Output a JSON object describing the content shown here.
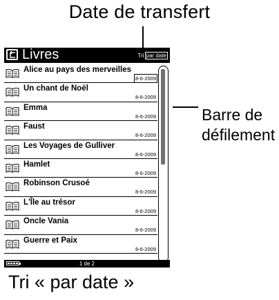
{
  "callouts": {
    "top": "Date de transfert",
    "right_line1": "Barre de",
    "right_line2": "défilement",
    "bottom": "Tri « par date »"
  },
  "header": {
    "back_icon": "back-arrow-icon",
    "title": "Livres",
    "sort_prefix": "Tri",
    "sort_value": "par date"
  },
  "books": [
    {
      "title": "Alice au pays des merveilles",
      "date": "8-6-2009",
      "icon": "book-icon",
      "highlighted": true
    },
    {
      "title": "Un chant de Noël",
      "date": "8-6-2009",
      "icon": "book-icon"
    },
    {
      "title": "Emma",
      "date": "8-6-2009",
      "icon": "book-icon"
    },
    {
      "title": "Faust",
      "date": "8-6-2009",
      "icon": "book-icon"
    },
    {
      "title": "Les Voyages de Gulliver",
      "date": "8-6-2009",
      "icon": "book-icon"
    },
    {
      "title": "Hamlet",
      "date": "8-6-2009",
      "icon": "book-icon"
    },
    {
      "title": "Robinson Crusoé",
      "date": "8-6-2009",
      "icon": "book-icon"
    },
    {
      "title": "L'Île au trésor",
      "date": "8-6-2009",
      "icon": "book-icon"
    },
    {
      "title": "Oncle Vania",
      "date": "8-6-2009",
      "icon": "book-icon"
    },
    {
      "title": "Guerre et Paix",
      "date": "8-6-2009",
      "icon": "book-icon"
    }
  ],
  "footer": {
    "battery_icon": "battery-icon",
    "page": "1 de 2"
  },
  "scroll": {
    "position_fraction": 0.0,
    "visible_fraction": 0.5
  },
  "colors": {
    "bar_background": "#000000",
    "scroll_thumb": "#6f6f6f"
  }
}
